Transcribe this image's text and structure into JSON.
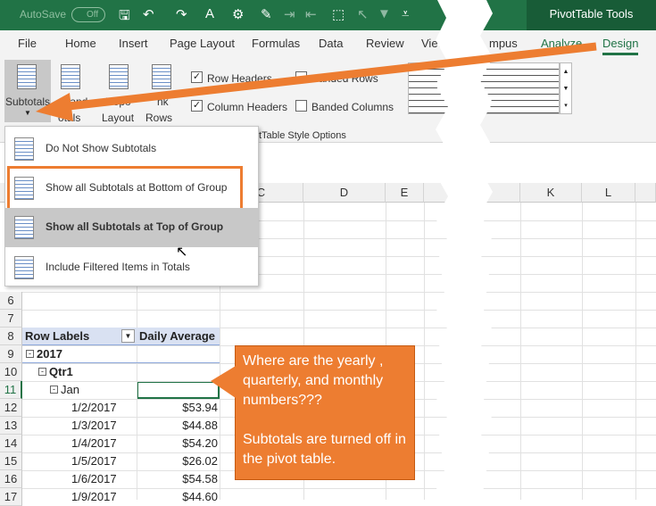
{
  "titlebar": {
    "autosave": "AutoSave",
    "toggle": "Off",
    "context_title": "PivotTable Tools"
  },
  "quick_access": [
    {
      "icon": "save-icon",
      "glyph": "🖫"
    },
    {
      "icon": "undo-icon",
      "glyph": "↶"
    },
    {
      "icon": "redo-icon",
      "glyph": "↷"
    },
    {
      "icon": "text-box-icon",
      "glyph": "A"
    },
    {
      "icon": "macro-icon",
      "glyph": "⚙"
    },
    {
      "icon": "format-painter-icon",
      "glyph": "✎"
    },
    {
      "icon": "increase-indent-icon",
      "glyph": "⇥"
    },
    {
      "icon": "decrease-indent-icon",
      "glyph": "⇤"
    },
    {
      "icon": "select-objects-icon",
      "glyph": "⬚"
    },
    {
      "icon": "cursor-icon",
      "glyph": "↖"
    },
    {
      "icon": "filter-icon",
      "glyph": "▼"
    },
    {
      "icon": "customize-icon",
      "glyph": "⩡"
    }
  ],
  "tabs": [
    "File",
    "Home",
    "Insert",
    "Page Layout",
    "Formulas",
    "Data",
    "Review",
    "View",
    "mpus",
    "Analyze",
    "Design"
  ],
  "active_tab": "Design",
  "ribbon": {
    "subtotals": "Subtotals",
    "grand": "Grand",
    "grand2": "otals",
    "report": "Repo",
    "layout": "Layout",
    "blank": "nk",
    "rows": "Rows",
    "row_headers": "Row Headers",
    "banded_rows": "Banded Rows",
    "column_headers": "Column Headers",
    "banded_columns": "Banded Columns",
    "group_label": "tTable Style Options"
  },
  "menu": {
    "items": [
      "Do Not Show Subtotals",
      "Show all Subtotals at Bottom of Group",
      "Show all Subtotals at Top of Group",
      "Include Filtered Items in Totals"
    ]
  },
  "columns": [
    "C",
    "D",
    "E",
    "K",
    "L"
  ],
  "rows": [
    "6",
    "7",
    "8",
    "9",
    "10",
    "11",
    "12",
    "13",
    "14",
    "15",
    "16",
    "17"
  ],
  "pivot": {
    "header_label": "Row Labels",
    "header_value": "Daily Average",
    "year": "2017",
    "quarter": "Qtr1",
    "month": "Jan",
    "data": [
      {
        "date": "1/2/2017",
        "value": "$53.94"
      },
      {
        "date": "1/3/2017",
        "value": "$44.88"
      },
      {
        "date": "1/4/2017",
        "value": "$54.20"
      },
      {
        "date": "1/5/2017",
        "value": "$26.02"
      },
      {
        "date": "1/6/2017",
        "value": "$54.58"
      },
      {
        "date": "1/9/2017",
        "value": "$44.60"
      }
    ]
  },
  "callout": {
    "line1": "Where are the yearly , quarterly, and monthly numbers???",
    "line2": "Subtotals are turned off in the pivot table."
  },
  "colors": {
    "excel_green": "#217346",
    "accent_orange": "#ed7d31"
  }
}
